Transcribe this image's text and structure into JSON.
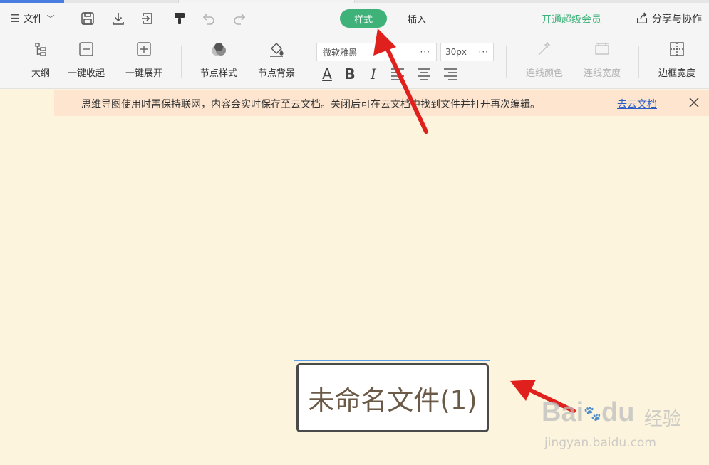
{
  "toolbar": {
    "file_label": "文件",
    "tabs": {
      "style": "样式",
      "insert": "插入"
    },
    "vip_label": "开通超级会员",
    "share_label": "分享与协作",
    "tools": {
      "outline": "大纲",
      "collapse_all": "一键收起",
      "expand_all": "一键展开",
      "node_style": "节点样式",
      "node_bg": "节点背景",
      "line_color": "连线颜色",
      "line_width": "连线宽度",
      "border_width": "边框宽度"
    },
    "font_family": "微软雅黑",
    "font_size": "30px",
    "format_buttons": [
      "A",
      "B",
      "I"
    ]
  },
  "notice": {
    "message": "思维导图使用时需保持联网，内容会实时保存至云文档。关闭后可在云文档中找到文件并打开再次编辑。",
    "link": "去云文档"
  },
  "canvas": {
    "root_node_text": "未命名文件(1)"
  },
  "watermark": {
    "brand": "Bai",
    "brand_suffix": "du",
    "product": "经验",
    "url": "jingyan.baidu.com"
  },
  "colors": {
    "accent_green": "#3fb27a",
    "canvas_bg": "#fcf4dc",
    "notice_bg": "#fde5cf",
    "annotation_red": "#e0201c"
  }
}
